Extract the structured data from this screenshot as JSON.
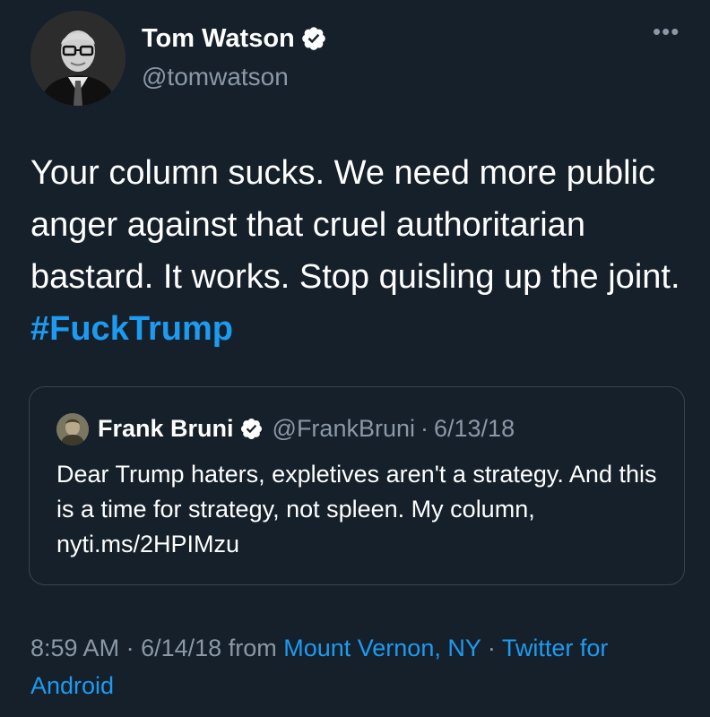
{
  "author": {
    "name": "Tom Watson",
    "handle": "@tomwatson",
    "avatar": "author-avatar-photo",
    "verified_icon": "verified-badge-icon"
  },
  "more_menu": {
    "label": "•••"
  },
  "tweet": {
    "text": "Your column sucks. We need more public anger against that cruel authoritarian bastard. It works. Stop quisling up the joint.",
    "hashtag": "#FuckTrump"
  },
  "quoted_tweet": {
    "name": "Frank Bruni",
    "handle": "@FrankBruni",
    "separator": "·",
    "date": "6/13/18",
    "text": "Dear Trump haters, expletives aren't a strategy. And this is a time for strategy, not spleen. My column, nyti.ms/2HPIMzu"
  },
  "footer": {
    "time": "8:59 AM",
    "separator": "·",
    "date": "6/14/18",
    "from_label": "from",
    "location": "Mount Vernon, NY",
    "client": "Twitter for Android"
  },
  "colors": {
    "background": "#15202b",
    "accent": "#1d9bf0",
    "muted": "#8b98a5",
    "border": "#38444d"
  }
}
